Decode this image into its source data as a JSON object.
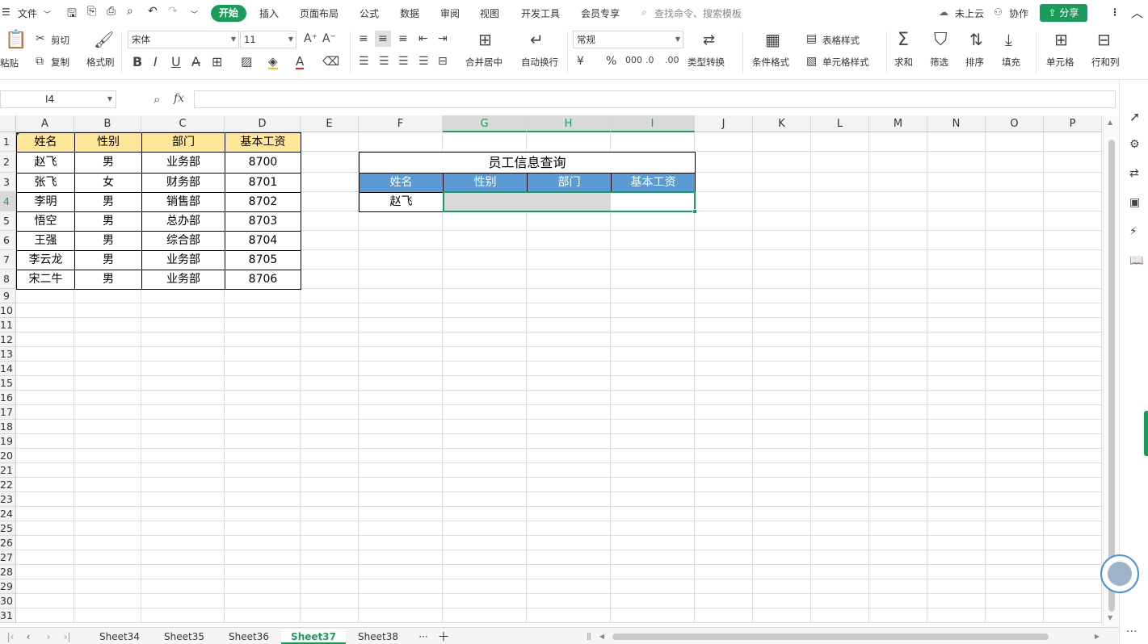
{
  "menu": {
    "file": "文件",
    "tabs": [
      "开始",
      "插入",
      "页面布局",
      "公式",
      "数据",
      "审阅",
      "视图",
      "开发工具",
      "会员专享"
    ],
    "search_placeholder": "查找命令、搜索模板",
    "cloud": "未上云",
    "collab": "协作",
    "share": "分享"
  },
  "ribbon": {
    "paste": "粘贴",
    "cut": "剪切",
    "copy": "复制",
    "format_painter": "格式刷",
    "font_name": "宋体",
    "font_size": "11",
    "merge_center": "合并居中",
    "wrap": "自动换行",
    "number_format": "常规",
    "type_convert": "类型转换",
    "cond_format": "条件格式",
    "table_style": "表格样式",
    "cell_style": "单元格样式",
    "sum": "求和",
    "filter": "筛选",
    "sort": "排序",
    "fill": "填充",
    "cell": "单元格",
    "row_col": "行和列"
  },
  "formula_bar": {
    "name_box": "I4",
    "fx": "fx",
    "formula": ""
  },
  "columns": [
    "A",
    "B",
    "C",
    "D",
    "E",
    "F",
    "G",
    "H",
    "I",
    "J",
    "K",
    "L",
    "M",
    "N",
    "O",
    "P"
  ],
  "rows": [
    "1",
    "2",
    "3",
    "4",
    "5",
    "6",
    "7",
    "8",
    "9",
    "10",
    "11",
    "12",
    "13",
    "14",
    "15",
    "16",
    "17",
    "18",
    "19",
    "20",
    "21",
    "22",
    "23",
    "24",
    "25",
    "26",
    "27",
    "28",
    "29",
    "30",
    "31"
  ],
  "table1": {
    "headers": [
      "姓名",
      "性别",
      "部门",
      "基本工资"
    ],
    "rows": [
      [
        "赵飞",
        "男",
        "业务部",
        "8700"
      ],
      [
        "张飞",
        "女",
        "财务部",
        "8701"
      ],
      [
        "李明",
        "男",
        "销售部",
        "8702"
      ],
      [
        "悟空",
        "男",
        "总办部",
        "8703"
      ],
      [
        "王强",
        "男",
        "综合部",
        "8704"
      ],
      [
        "李云龙",
        "男",
        "业务部",
        "8705"
      ],
      [
        "宋二牛",
        "男",
        "业务部",
        "8706"
      ]
    ]
  },
  "query": {
    "title": "员工信息查询",
    "headers": [
      "姓名",
      "性别",
      "部门",
      "基本工资"
    ],
    "name_value": "赵飞"
  },
  "sheets": [
    "Sheet34",
    "Sheet35",
    "Sheet36",
    "Sheet37",
    "Sheet38"
  ],
  "active_sheet": "Sheet37",
  "colors": {
    "accent": "#1a9d5b",
    "header_yellow": "#ffe699",
    "header_blue": "#5b9bd5"
  }
}
